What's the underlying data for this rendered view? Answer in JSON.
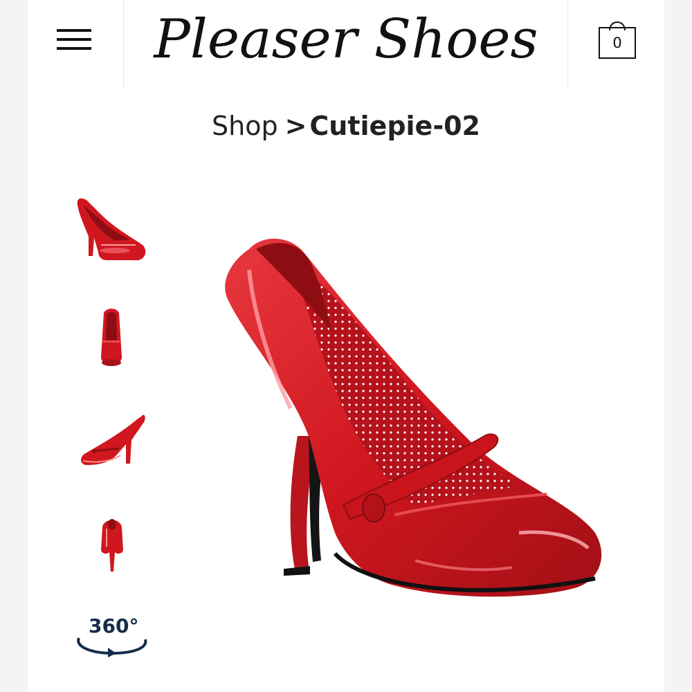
{
  "header": {
    "brand": "Pleaser Shoes",
    "menu_icon": "hamburger-menu-icon",
    "cart_icon": "shopping-bag-icon",
    "cart_count": "0"
  },
  "breadcrumb": {
    "shop": "Shop",
    "separator": ">",
    "current": "Cutiepie-02"
  },
  "gallery": {
    "thumbnails": [
      "side-view",
      "front-view",
      "outer-side-view",
      "back-view"
    ],
    "view360_label": "360°",
    "view360_icon": "rotate-360-icon"
  },
  "colors": {
    "shoe_red": "#d0171f",
    "shoe_dark_red": "#8e0d12",
    "text": "#222222"
  }
}
